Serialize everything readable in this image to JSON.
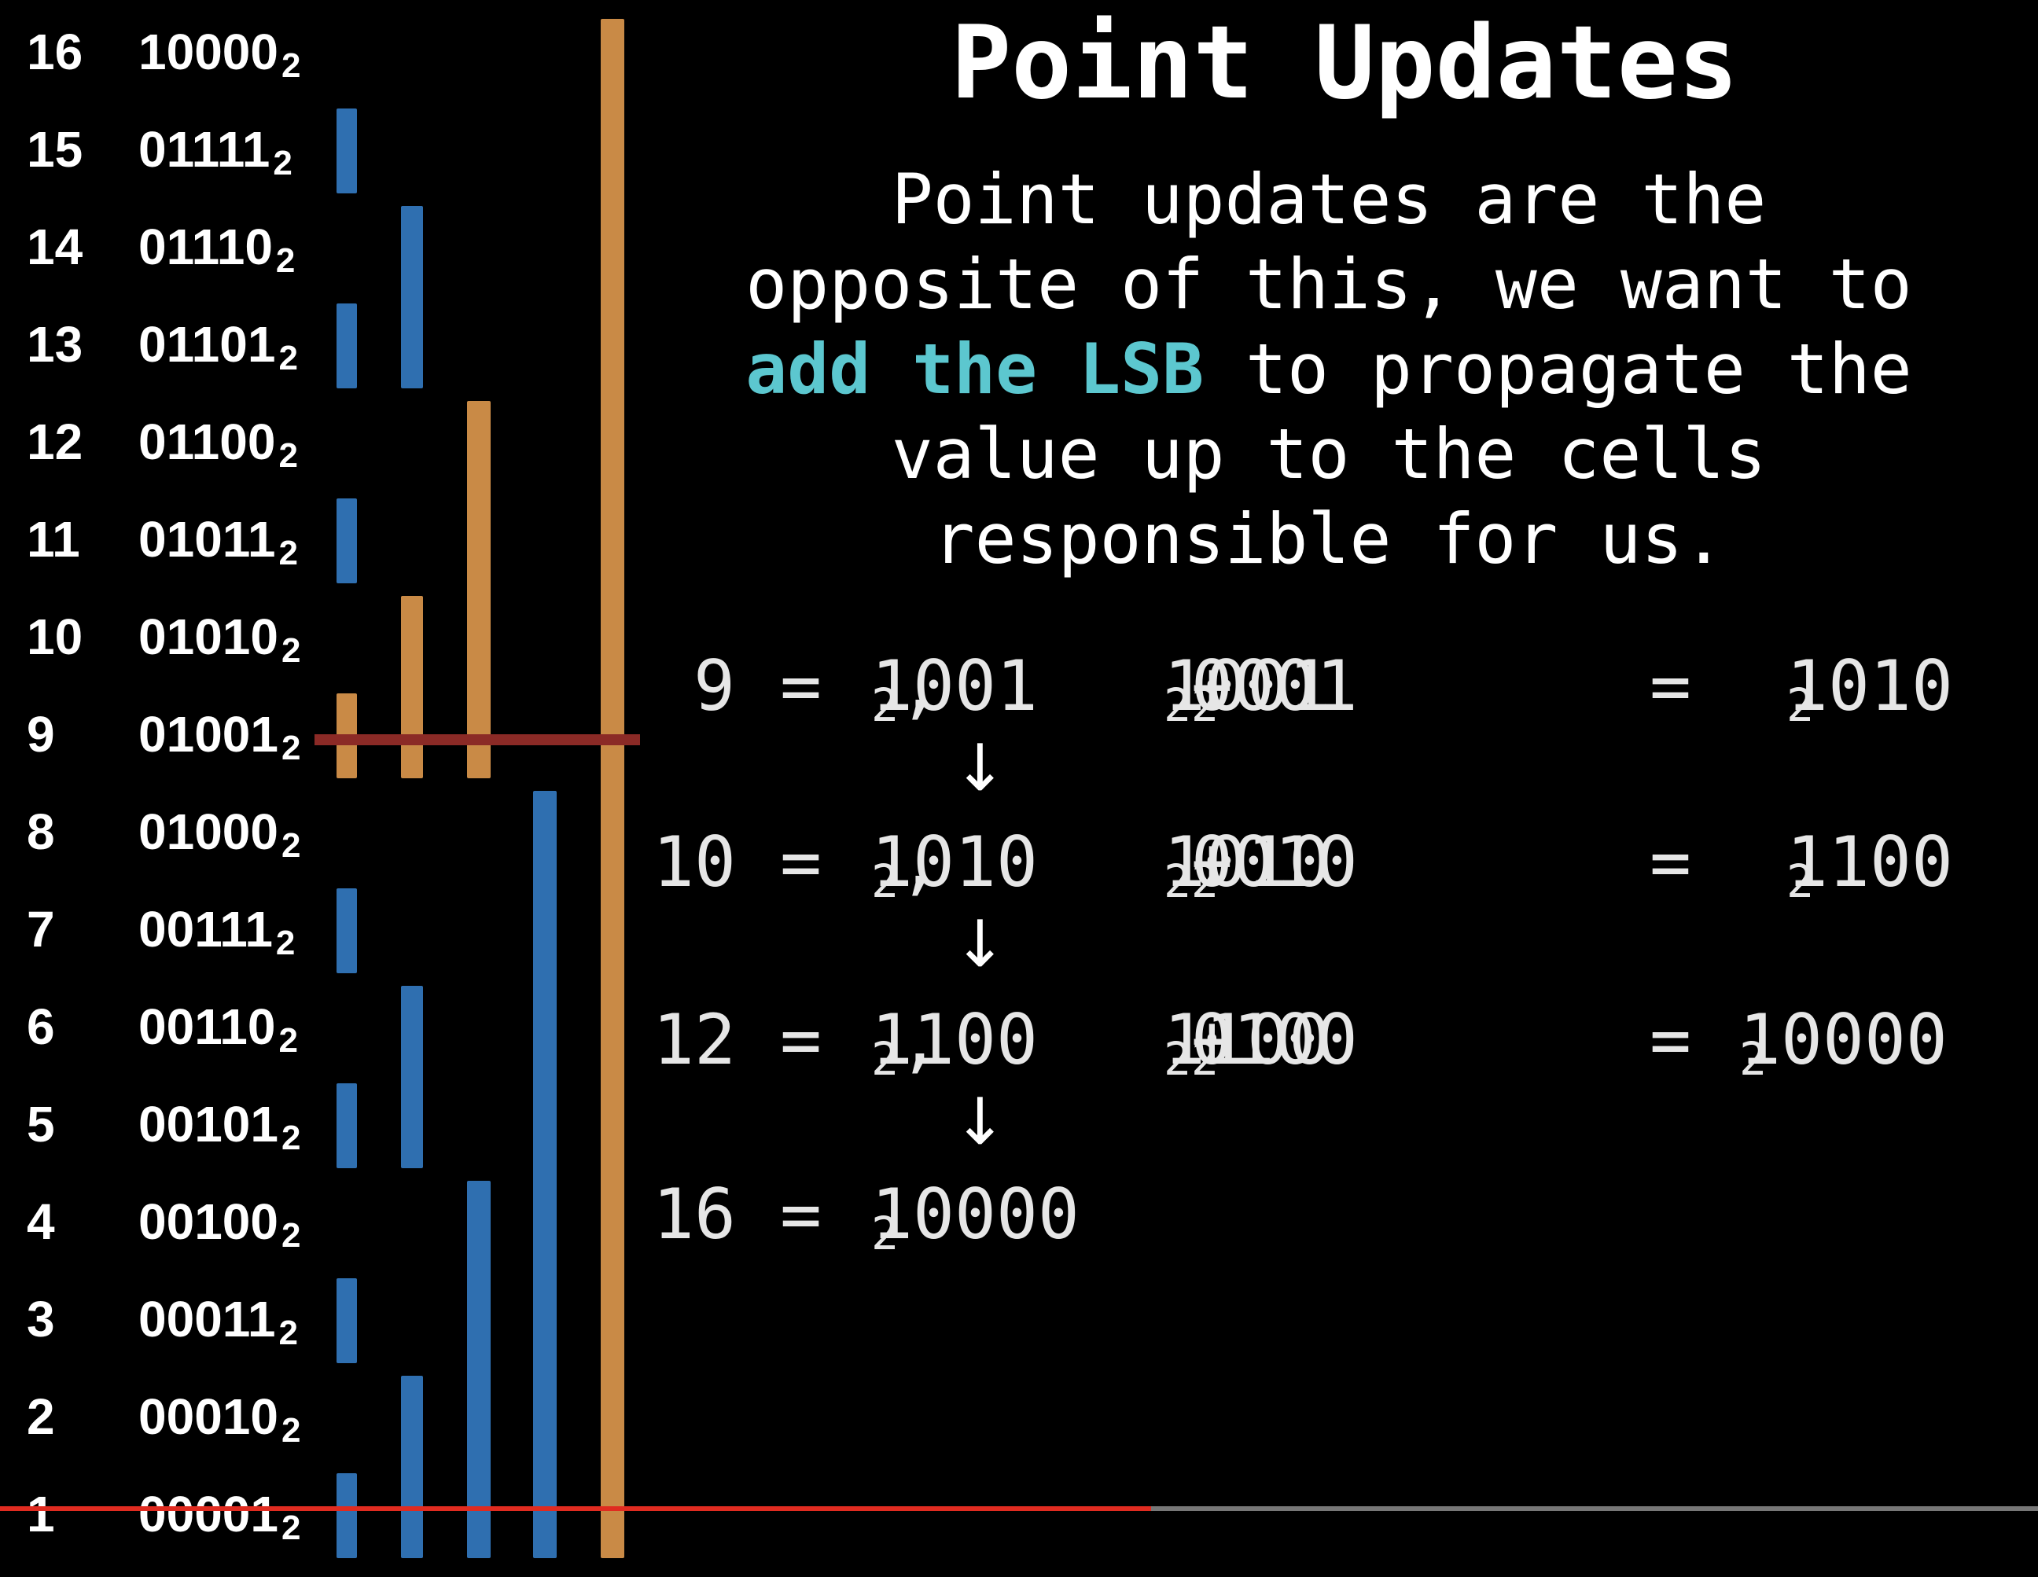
{
  "title": "Point Updates",
  "paragraph": {
    "line1": "Point updates are the",
    "line2": "opposite of this, we want to",
    "line3_highlight": "add the LSB",
    "line3_rest": " to propagate the",
    "line4": "value up to the cells",
    "line5": "responsible for us."
  },
  "subscript": "2",
  "rows": [
    {
      "index": "16",
      "binary": "10000"
    },
    {
      "index": "15",
      "binary": "01111"
    },
    {
      "index": "14",
      "binary": "01110"
    },
    {
      "index": "13",
      "binary": "01101"
    },
    {
      "index": "12",
      "binary": "01100"
    },
    {
      "index": "11",
      "binary": "01011"
    },
    {
      "index": "10",
      "binary": "01010"
    },
    {
      "index": "9",
      "binary": "01001"
    },
    {
      "index": "8",
      "binary": "01000"
    },
    {
      "index": "7",
      "binary": "00111"
    },
    {
      "index": "6",
      "binary": "00110"
    },
    {
      "index": "5",
      "binary": "00101"
    },
    {
      "index": "4",
      "binary": "00100"
    },
    {
      "index": "3",
      "binary": "00011"
    },
    {
      "index": "2",
      "binary": "00010"
    },
    {
      "index": "1",
      "binary": "00001"
    }
  ],
  "equations": [
    {
      "lhs": "9",
      "a": "1001",
      "b": "1001",
      "c": "0001",
      "result": "1010"
    },
    {
      "lhs": "10",
      "a": "1010",
      "b": "1010",
      "c": "0010",
      "result": "1100"
    },
    {
      "lhs": "12",
      "a": "1100",
      "b": "1100",
      "c": "0100",
      "result": "10000"
    }
  ],
  "final": {
    "lhs": "16",
    "a": "10000"
  },
  "bars": [
    {
      "cell": 1,
      "lsb": 1
    },
    {
      "cell": 2,
      "lsb": 2
    },
    {
      "cell": 3,
      "lsb": 1
    },
    {
      "cell": 4,
      "lsb": 4
    },
    {
      "cell": 5,
      "lsb": 1
    },
    {
      "cell": 6,
      "lsb": 2
    },
    {
      "cell": 7,
      "lsb": 1
    },
    {
      "cell": 8,
      "lsb": 8
    },
    {
      "cell": 9,
      "lsb": 1
    },
    {
      "cell": 10,
      "lsb": 2
    },
    {
      "cell": 11,
      "lsb": 1
    },
    {
      "cell": 12,
      "lsb": 4
    },
    {
      "cell": 13,
      "lsb": 1
    },
    {
      "cell": 14,
      "lsb": 2
    },
    {
      "cell": 15,
      "lsb": 1
    },
    {
      "cell": 16,
      "lsb": 16
    }
  ],
  "highlighted_cells": [
    9,
    10,
    12,
    16
  ],
  "highlight_row": 9,
  "colors": {
    "blue_bar": "#2f6fb0",
    "orange_bar": "#c98a46",
    "highlight_line": "#8b2a26",
    "lsb_text": "#5cc7cf"
  },
  "video_progress": 0.565
}
